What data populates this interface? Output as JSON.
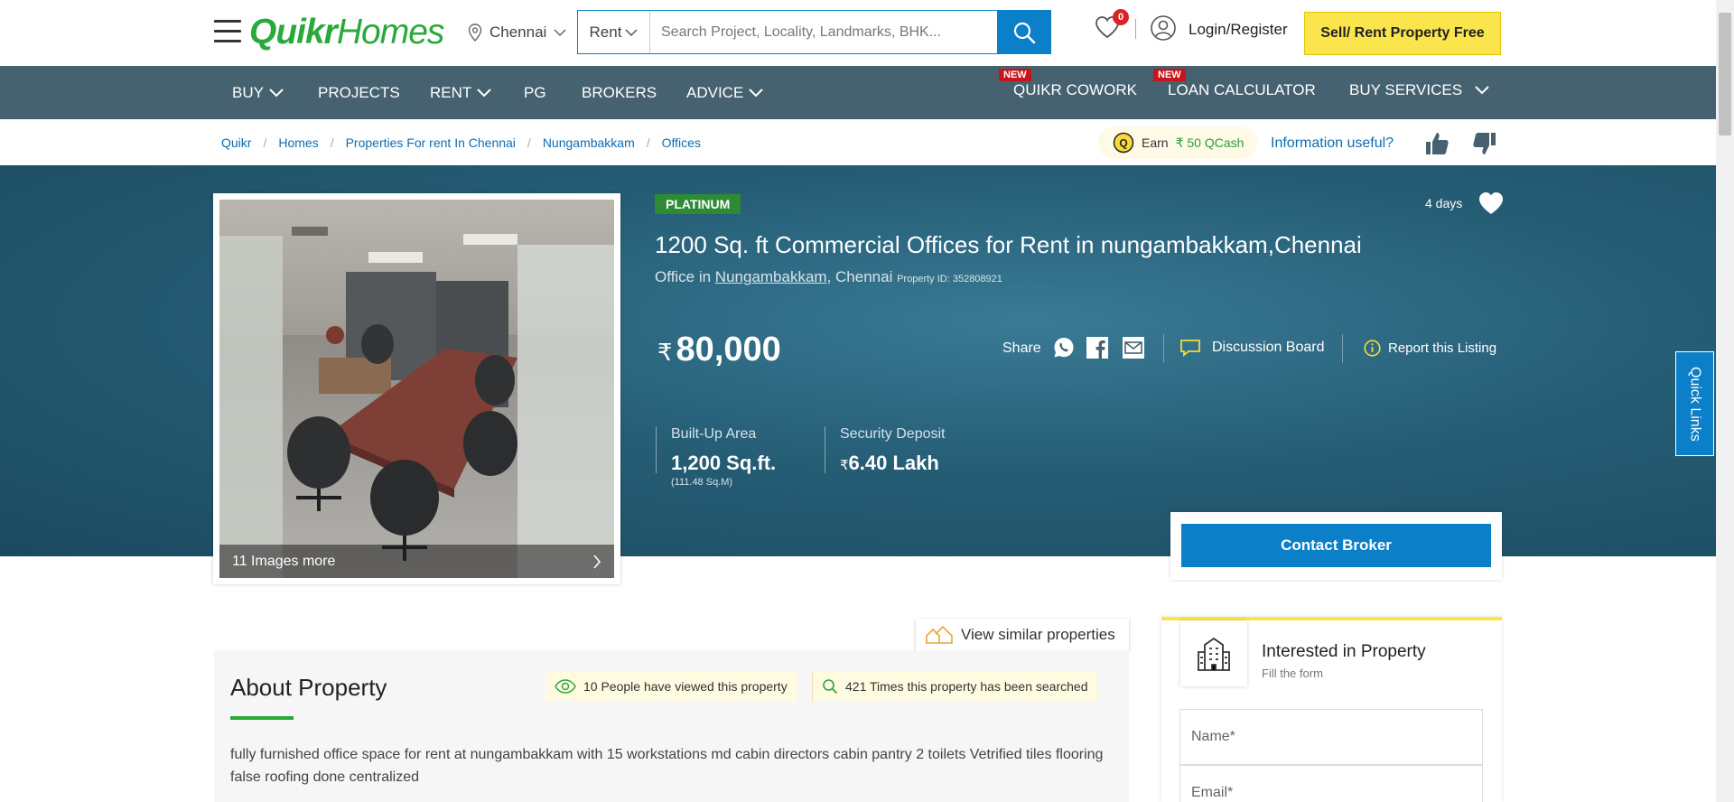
{
  "header": {
    "logo_quikr": "Quikr",
    "logo_homes": "Homes",
    "city": "Chennai",
    "search_type": "Rent",
    "search_placeholder": "Search Project, Locality, Landmarks, BHK...",
    "wishlist_count": "0",
    "login_label": "Login/Register",
    "sell_button": "Sell/ Rent Property Free"
  },
  "nav": {
    "items": [
      "BUY",
      "PROJECTS",
      "RENT",
      "PG",
      "BROKERS",
      "ADVICE",
      "QUIKR COWORK",
      "LOAN CALCULATOR",
      "BUY SERVICES"
    ],
    "new_tag": "NEW"
  },
  "breadcrumb": [
    "Quikr",
    "Homes",
    "Properties For rent In Chennai",
    "Nungambakkam",
    "Offices"
  ],
  "feedback": {
    "qcash_prefix": "Earn",
    "qcash_amount": "₹ 50 QCash",
    "info_useful": "Information useful?"
  },
  "listing": {
    "badge": "PLATINUM",
    "posted": "4 days",
    "title": "1200 Sq. ft Commercial Offices for Rent in nungambakkam,Chennai",
    "type_prefix": "Office in",
    "locality": "Nungambakkam",
    "city_suffix": ", Chennai",
    "property_id": "Property ID: 352808921",
    "currency": "₹",
    "price": "80,000",
    "share_label": "Share",
    "discussion_board": "Discussion Board",
    "report_listing": "Report this Listing",
    "images_more": "11 Images more",
    "built_up_label": "Built-Up Area",
    "built_up_value": "1,200 Sq.ft.",
    "built_up_sub": "(111.48 Sq.M)",
    "deposit_label": "Security Deposit",
    "deposit_currency": "₹",
    "deposit_value": "6.40 Lakh",
    "contact_button": "Contact Broker"
  },
  "quick_links": "Quick Links",
  "about": {
    "similar_button": "View similar properties",
    "heading": "About Property",
    "viewed": "10 People have viewed this property",
    "searched": "421 Times this property has been searched",
    "description": "fully furnished office space for rent at nungambakkam with 15 workstations md cabin directors cabin pantry 2 toilets Vetrified tiles flooring false roofing done centralized"
  },
  "form": {
    "heading": "Interested in Property",
    "subheading": "Fill the form",
    "name_placeholder": "Name*",
    "email_placeholder": "Email*"
  },
  "colors": {
    "brand_green": "#2aa83b",
    "primary_blue": "#0b7fc8",
    "nav_bg": "#466270",
    "sell_yellow": "#fbe54d",
    "platinum_green": "#2e8b34"
  }
}
